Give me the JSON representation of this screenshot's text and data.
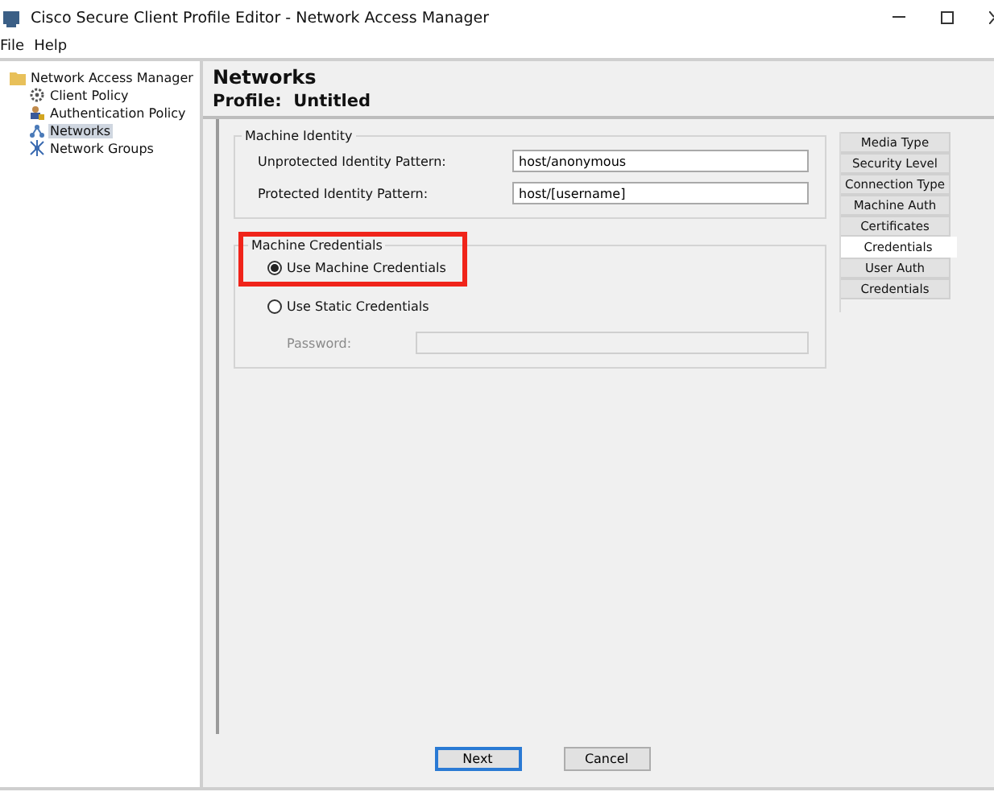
{
  "window": {
    "title": "Cisco Secure Client Profile Editor - Network Access Manager"
  },
  "menu": [
    "File",
    "Help"
  ],
  "tree": {
    "label": "Network Access Manager",
    "children": [
      {
        "label": "Client Policy",
        "kind": "gear",
        "selected": false
      },
      {
        "label": "Authentication Policy",
        "kind": "user",
        "selected": false
      },
      {
        "label": "Networks",
        "kind": "network",
        "selected": true
      },
      {
        "label": "Network Groups",
        "kind": "groups",
        "selected": false
      }
    ]
  },
  "header": {
    "title": "Networks",
    "profile_label": "Profile:",
    "profile_name": "Untitled"
  },
  "machine_identity": {
    "legend": "Machine Identity",
    "fields": [
      {
        "label": "Unprotected Identity Pattern:",
        "value": "host/anonymous"
      },
      {
        "label": "Protected Identity Pattern:",
        "value": "host/[username]"
      }
    ]
  },
  "machine_credentials": {
    "legend": "Machine Credentials",
    "options": [
      {
        "label": "Use Machine Credentials",
        "selected": true,
        "highlighted": true
      },
      {
        "label": "Use Static Credentials",
        "selected": false,
        "highlighted": false
      }
    ],
    "password": {
      "label": "Password:",
      "disabled": true
    }
  },
  "side_tabs": [
    {
      "label": "Media Type",
      "selected": false
    },
    {
      "label": "Security Level",
      "selected": false
    },
    {
      "label": "Connection Type",
      "selected": false
    },
    {
      "label": "Machine Auth",
      "selected": false
    },
    {
      "label": "Certificates",
      "selected": false
    },
    {
      "label": "Credentials",
      "selected": true
    },
    {
      "label": "User Auth",
      "selected": false
    },
    {
      "label": "Credentials",
      "selected": false
    }
  ],
  "buttons": [
    {
      "label": "Next",
      "default": true
    },
    {
      "label": "Cancel",
      "default": false
    }
  ]
}
